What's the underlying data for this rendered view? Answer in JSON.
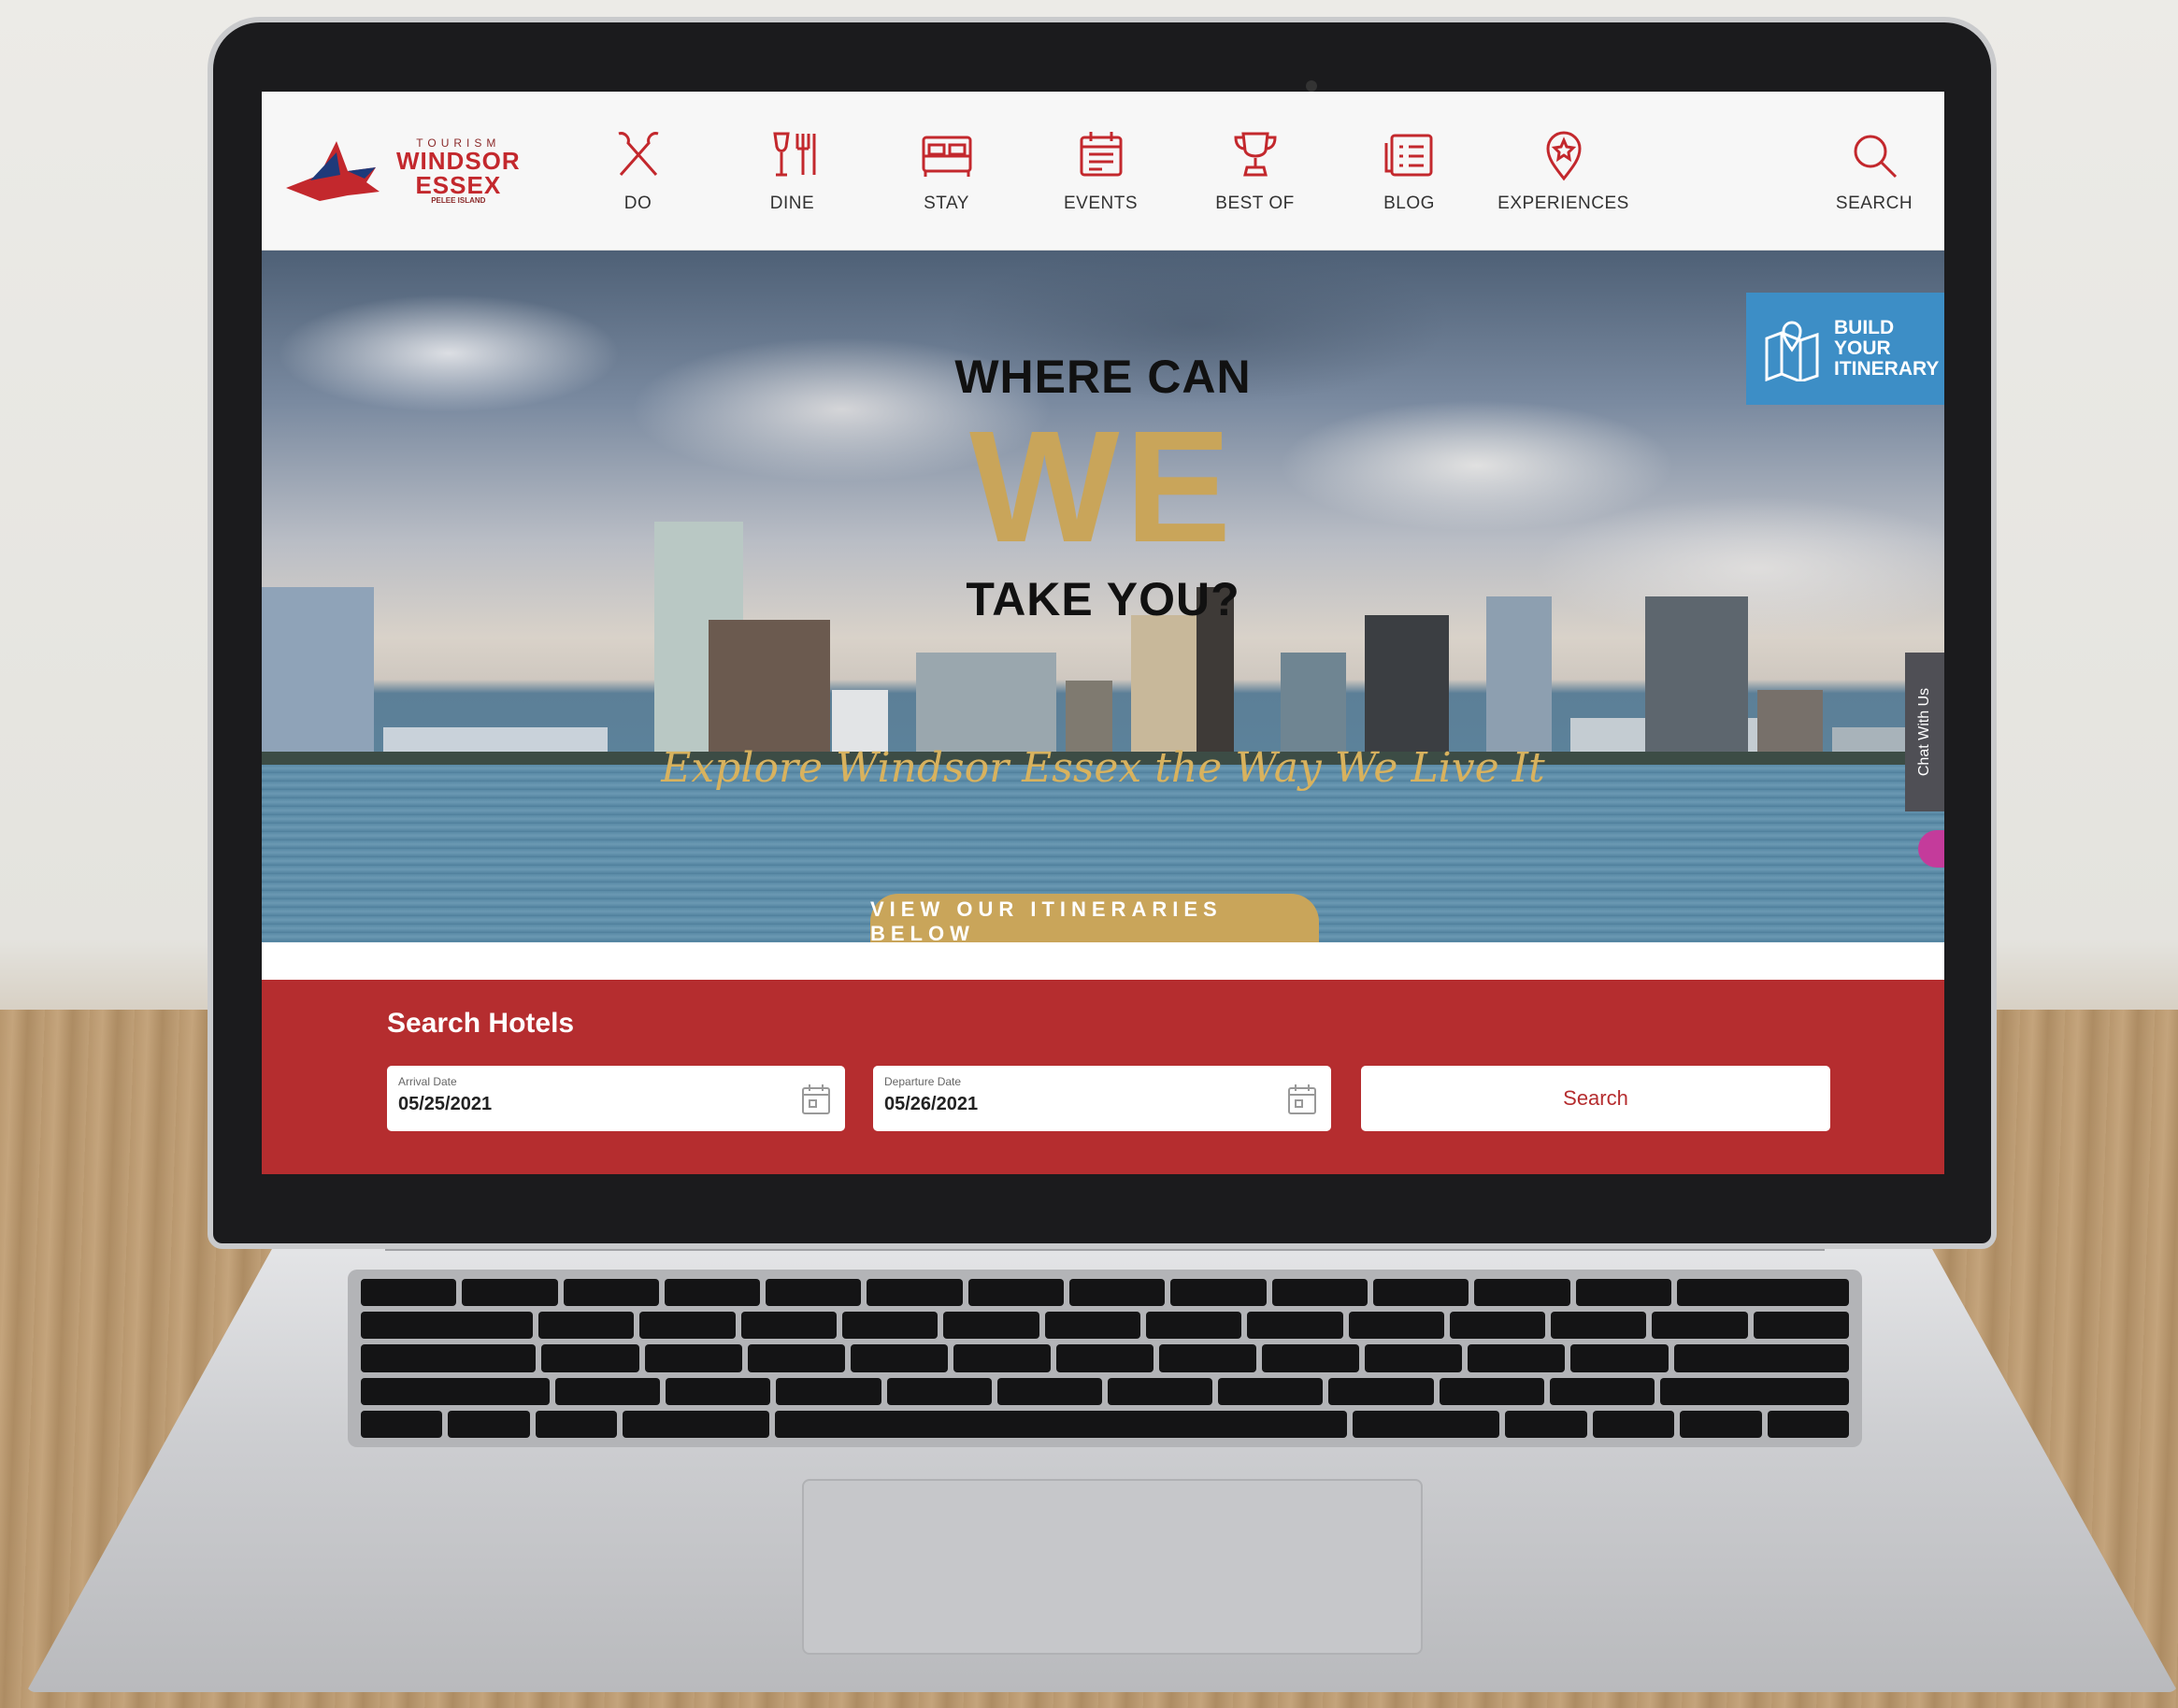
{
  "site": {
    "logo": {
      "small": "TOURISM",
      "line1": "WINDSOR",
      "line2": "ESSEX",
      "tiny": "PELEE ISLAND"
    },
    "nav": [
      {
        "label": "DO",
        "icon": "paddles-icon"
      },
      {
        "label": "DINE",
        "icon": "wine-utensils-icon"
      },
      {
        "label": "STAY",
        "icon": "bed-icon"
      },
      {
        "label": "EVENTS",
        "icon": "calendar-icon"
      },
      {
        "label": "BEST OF",
        "icon": "trophy-icon"
      },
      {
        "label": "BLOG",
        "icon": "list-icon"
      },
      {
        "label": "EXPERIENCES",
        "icon": "location-pin-icon"
      }
    ],
    "search_label": "SEARCH"
  },
  "hero": {
    "line1": "WHERE CAN",
    "line2": "WE",
    "line3": "TAKE YOU?",
    "script": "Explore Windsor Essex the Way We Live It",
    "button": "VIEW OUR ITINERARIES BELOW",
    "build": [
      "BUILD",
      "YOUR",
      "ITINERARY"
    ],
    "chat": "Chat With Us"
  },
  "hotel_search": {
    "title": "Search Hotels",
    "arrival_label": "Arrival Date",
    "arrival_value": "05/25/2021",
    "departure_label": "Departure Date",
    "departure_value": "05/26/2021",
    "button": "Search"
  },
  "colors": {
    "brand_red": "#b52d2f",
    "gold": "#c9a55a",
    "itinerary_blue": "#3d8ec6"
  }
}
